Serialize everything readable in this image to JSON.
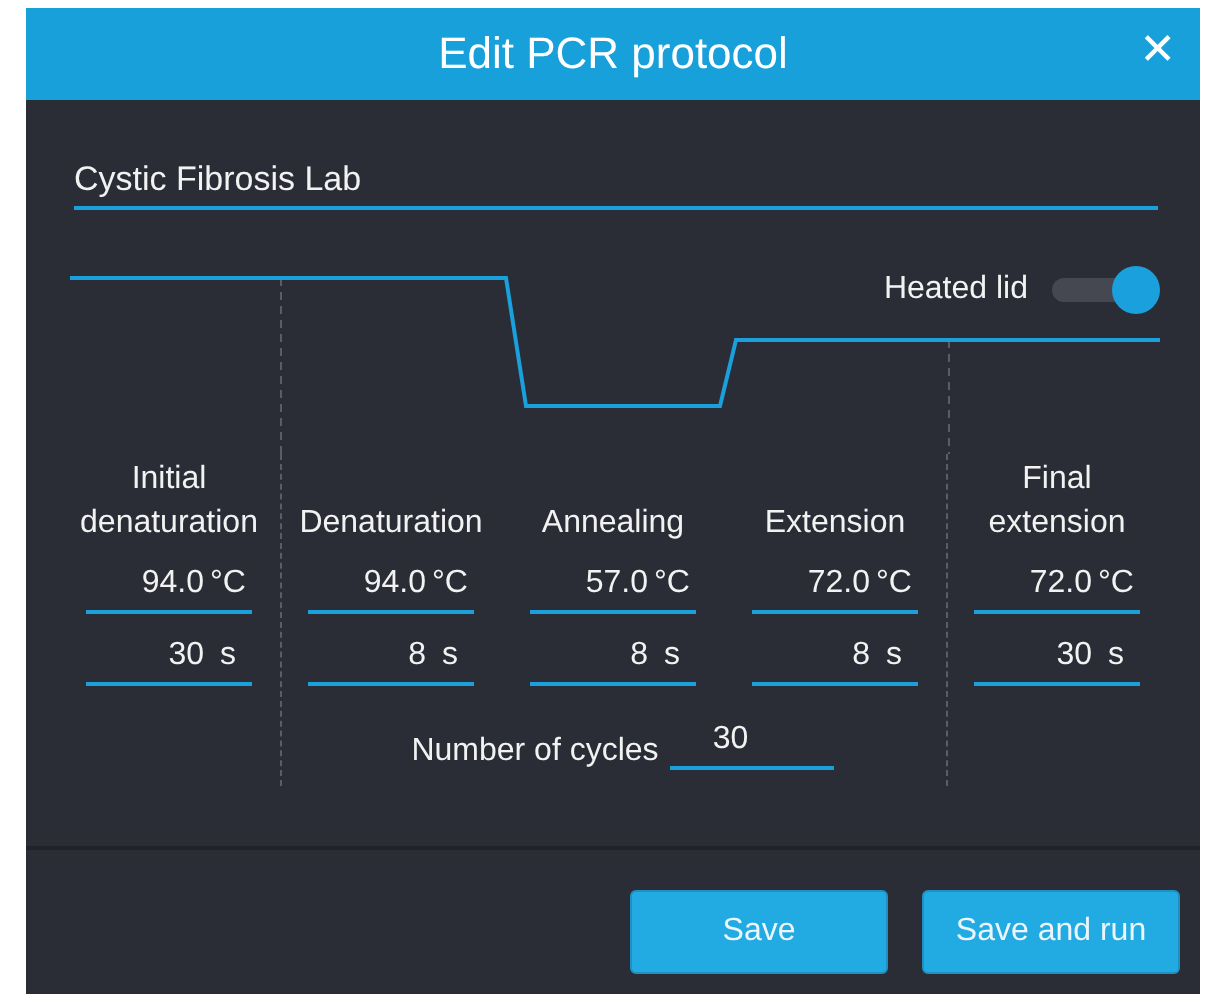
{
  "dialog": {
    "title": "Edit PCR protocol",
    "close": "✕"
  },
  "protocol_name": {
    "value": "Cystic Fibrosis Lab"
  },
  "heated_lid": {
    "label": "Heated lid",
    "on": true
  },
  "steps": [
    {
      "label": "Initial denaturation",
      "temperature": "94.0",
      "temperature_unit": "°C",
      "duration": "30",
      "duration_unit": "s"
    },
    {
      "label": "Denaturation",
      "temperature": "94.0",
      "temperature_unit": "°C",
      "duration": "8",
      "duration_unit": "s"
    },
    {
      "label": "Annealing",
      "temperature": "57.0",
      "temperature_unit": "°C",
      "duration": "8",
      "duration_unit": "s"
    },
    {
      "label": "Extension",
      "temperature": "72.0",
      "temperature_unit": "°C",
      "duration": "8",
      "duration_unit": "s"
    },
    {
      "label": "Final extension",
      "temperature": "72.0",
      "temperature_unit": "°C",
      "duration": "30",
      "duration_unit": "s"
    }
  ],
  "cycles": {
    "label": "Number of cycles",
    "value": "30"
  },
  "buttons": [
    "Save",
    "Save and run"
  ]
}
